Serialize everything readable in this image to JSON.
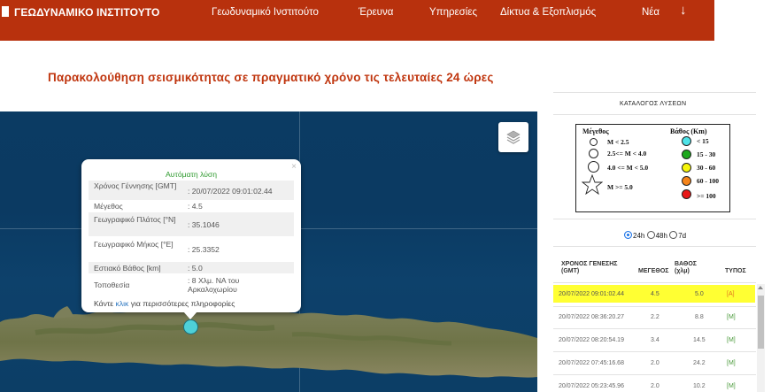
{
  "header": {
    "logo_text": "ΓΕΩΔΥΝΑΜΙΚΟ ΙΝΣΤΙΤΟΥΤΟ",
    "nav": [
      "Γεωδυναμικό Ινστιτούτο",
      "Έρευνα",
      "Υπηρεσίες",
      "Δίκτυα & Εξοπλισμός",
      "Νέα"
    ],
    "nav_arrow": "↓",
    "brand_color": "#b8310d"
  },
  "page_title": "Παρακολούθηση σεισμικότητας σε πραγματικό χρόνο τις τελευταίες 24 ώρες",
  "popup": {
    "heading": "Αυτόματη λύση",
    "close": "×",
    "rows": [
      {
        "label": "Χρόνος Γέννησης [GMT]",
        "value": ": 20/07/2022 09:01:02.44"
      },
      {
        "label": "Μέγεθος",
        "value": ": 4.5"
      },
      {
        "label": "Γεωγραφικό Πλάτος [°N]",
        "value": ": 35.1046"
      },
      {
        "label": "Γεωγραφικό Μήκος [°E]",
        "value": ": 25.3352"
      },
      {
        "label": "Εστιακό Βάθος [km]",
        "value": ": 5.0"
      },
      {
        "label": "Τοποθεσία",
        "value": ": 8 Χλμ. ΝΑ του Αρκαλοχωρίου"
      }
    ],
    "footer_pre": "Κάντε ",
    "footer_link": "κλικ",
    "footer_post": " για περισσότερες πληροφορίες"
  },
  "panel": {
    "title": "ΚΑΤΑΛΟΓΟΣ ΛΥΣΕΩΝ",
    "legend": {
      "magnitude_heading": "Μέγεθος",
      "depth_heading": "Βάθος (Km)",
      "magnitudes": [
        "M < 2.5",
        "2.5<= M < 4.0",
        "4.0 <= M < 5.0",
        "M >= 5.0"
      ],
      "depths": [
        {
          "label": "< 15",
          "color": "#4ee3e8"
        },
        {
          "label": "15 - 30",
          "color": "#1ea81e"
        },
        {
          "label": "30 - 60",
          "color": "#f5f50a"
        },
        {
          "label": "60 - 100",
          "color": "#f5841a"
        },
        {
          "label": ">= 100",
          "color": "#e81818"
        }
      ]
    },
    "periods": [
      "24h",
      "48h",
      "7d"
    ],
    "selected_period": "24h",
    "columns": [
      "ΧΡΟΝΟΣ ΓΕΝΕΣΗΣ (GMT)",
      "ΜΕΓΕΘΟΣ",
      "ΒΑΘΟΣ (χλμ)",
      "ΤΥΠΟΣ"
    ],
    "rows": [
      {
        "time": "20/07/2022 09:01:02.44",
        "mag": "4.5",
        "depth": "5.0",
        "type": "[A]",
        "highlight": true
      },
      {
        "time": "20/07/2022 08:36:20.27",
        "mag": "2.2",
        "depth": "8.8",
        "type": "[M]"
      },
      {
        "time": "20/07/2022 08:20:54.19",
        "mag": "3.4",
        "depth": "14.5",
        "type": "[M]"
      },
      {
        "time": "20/07/2022 07:45:16.68",
        "mag": "2.0",
        "depth": "24.2",
        "type": "[M]"
      },
      {
        "time": "20/07/2022 05:23:45.96",
        "mag": "2.0",
        "depth": "10.2",
        "type": "[M]"
      }
    ]
  }
}
